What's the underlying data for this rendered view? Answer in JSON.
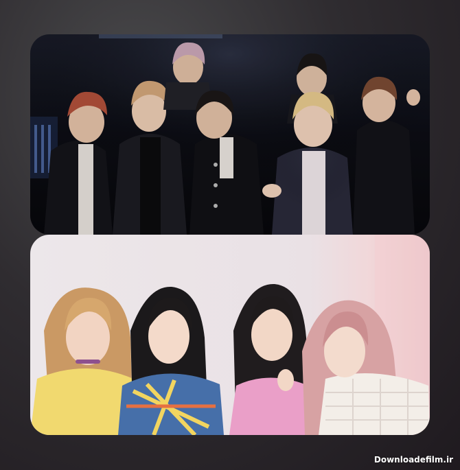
{
  "watermark": {
    "text": "Downloadefilm.ir"
  },
  "photos": {
    "top": {
      "subject": "group-photo-seven-men-stage",
      "background_color": "#0c0d14"
    },
    "bottom": {
      "subject": "group-photo-four-women-wall",
      "background_color": "#e9e2e6"
    }
  }
}
